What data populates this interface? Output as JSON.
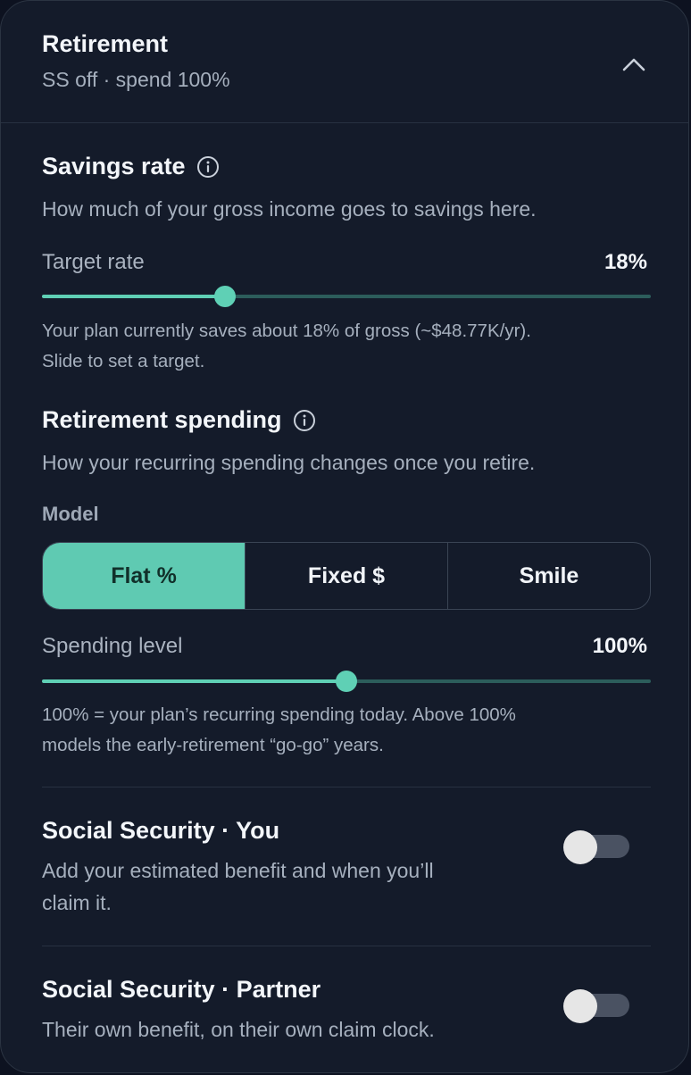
{
  "header": {
    "title": "Retirement",
    "subtitle": "SS off · spend 100%",
    "collapse_icon": "chevron-up-icon"
  },
  "savings": {
    "title": "Savings rate",
    "info_icon": "info-icon",
    "description": "How much of your gross income goes to savings here.",
    "target_label": "Target rate",
    "target_value": "18%",
    "slider_fraction": 0.3,
    "note_line1": "Your plan currently saves about 18% of gross (~$48.77K/yr).",
    "note_line2": "Slide to set a target."
  },
  "spending": {
    "title": "Retirement spending",
    "info_icon": "info-icon",
    "description": "How your recurring spending changes once you retire.",
    "model_label": "Model",
    "models": [
      "Flat %",
      "Fixed $",
      "Smile"
    ],
    "selected_model": "Flat %",
    "level_label": "Spending level",
    "level_value": "100%",
    "slider_fraction": 0.5,
    "note_line1": "100% = your plan’s recurring spending today. Above 100%",
    "note_line2": "models the early-retirement “go-go” years."
  },
  "ss_you": {
    "title": "Social Security · You",
    "description_line1": "Add your estimated benefit and when you’ll",
    "description_line2": "claim it.",
    "enabled": false
  },
  "ss_partner": {
    "title": "Social Security · Partner",
    "description": "Their own benefit, on their own claim clock.",
    "enabled": false
  },
  "colors": {
    "accent": "#5fd0b5",
    "background": "#141b2a",
    "track_inactive": "#2c5d5b"
  }
}
